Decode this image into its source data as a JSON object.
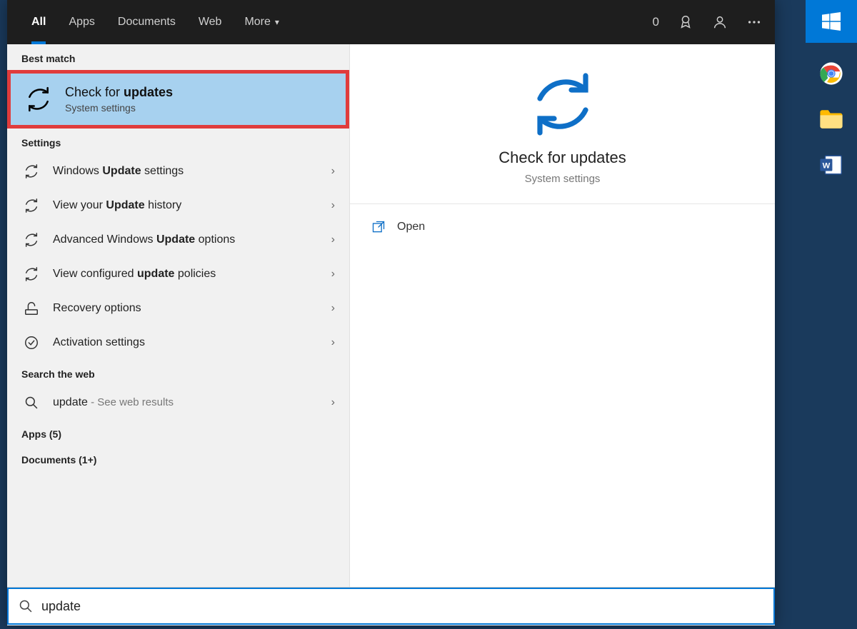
{
  "tabs": {
    "items": [
      "All",
      "Apps",
      "Documents",
      "Web",
      "More"
    ],
    "active_index": 0,
    "score": "0"
  },
  "sections": {
    "best_match_header": "Best match",
    "best_match": {
      "title_pre": "Check for ",
      "title_bold": "updates",
      "subtitle": "System settings"
    },
    "settings_header": "Settings",
    "settings_items": [
      {
        "pre": "Windows ",
        "bold": "Update",
        "post": " settings",
        "icon": "refresh"
      },
      {
        "pre": "View your ",
        "bold": "Update",
        "post": " history",
        "icon": "refresh"
      },
      {
        "pre": "Advanced Windows ",
        "bold": "Update",
        "post": " options",
        "icon": "refresh"
      },
      {
        "pre": "View configured ",
        "bold": "update",
        "post": " policies",
        "icon": "refresh"
      },
      {
        "pre": "Recovery options",
        "bold": "",
        "post": "",
        "icon": "recovery"
      },
      {
        "pre": "Activation settings",
        "bold": "",
        "post": "",
        "icon": "check"
      }
    ],
    "web_header": "Search the web",
    "web_item": {
      "term": "update",
      "suffix": " - See web results"
    },
    "apps_header": "Apps (5)",
    "documents_header": "Documents (1+)"
  },
  "preview": {
    "title": "Check for updates",
    "subtitle": "System settings",
    "action": "Open"
  },
  "search": {
    "value": "update"
  }
}
